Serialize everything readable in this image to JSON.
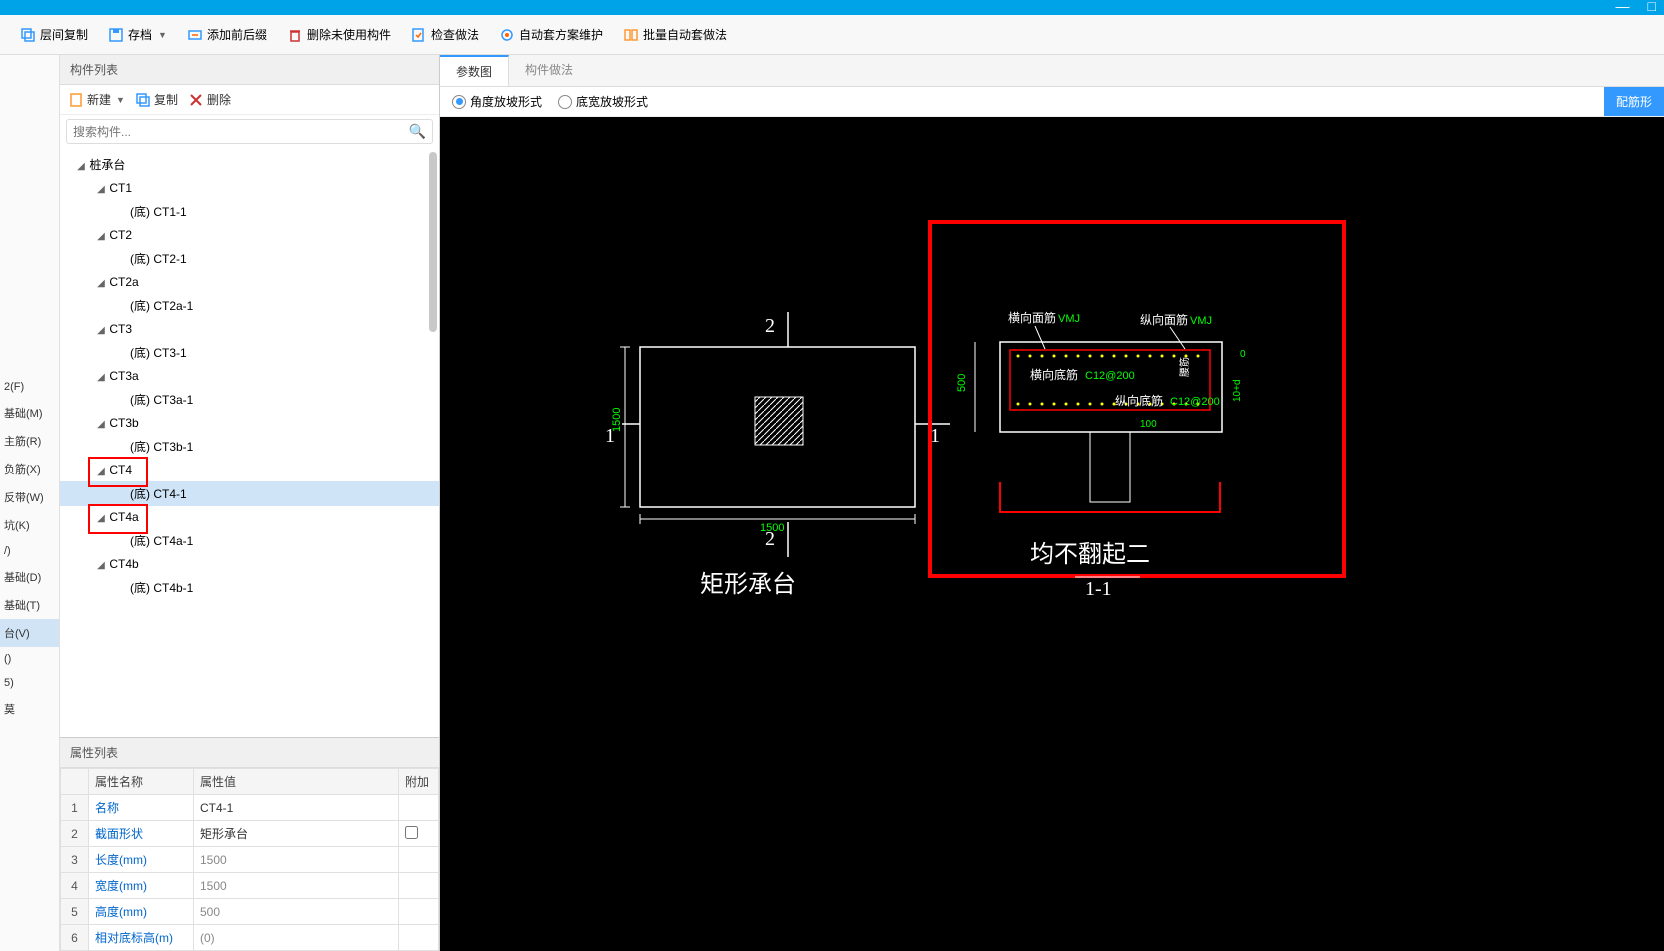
{
  "toolbar": [
    {
      "label": "层间复制"
    },
    {
      "label": "存档",
      "dropdown": true
    },
    {
      "label": "添加前后缀"
    },
    {
      "label": "删除未使用构件"
    },
    {
      "label": "检查做法"
    },
    {
      "label": "自动套方案维护"
    },
    {
      "label": "批量自动套做法"
    }
  ],
  "left_sidebar": [
    {
      "label": "2(F)"
    },
    {
      "label": "基础(M)"
    },
    {
      "label": "主筋(R)"
    },
    {
      "label": "负筋(X)"
    },
    {
      "label": "反带(W)"
    },
    {
      "label": "坑(K)"
    },
    {
      "label": "/)"
    },
    {
      "label": "基础(D)"
    },
    {
      "label": "基础(T)"
    },
    {
      "label": "台(V)",
      "active": true
    },
    {
      "label": "()"
    },
    {
      "label": "5)"
    },
    {
      "label": "莫"
    }
  ],
  "center": {
    "header": "构件列表",
    "tools": {
      "new": "新建",
      "copy": "复制",
      "delete": "删除"
    },
    "search_placeholder": "搜索构件...",
    "tree": [
      {
        "level": 0,
        "label": "桩承台",
        "expanded": true
      },
      {
        "level": 1,
        "label": "CT1",
        "expanded": true
      },
      {
        "level": 2,
        "label": "(底) CT1-1"
      },
      {
        "level": 1,
        "label": "CT2",
        "expanded": true
      },
      {
        "level": 2,
        "label": "(底) CT2-1"
      },
      {
        "level": 1,
        "label": "CT2a",
        "expanded": true
      },
      {
        "level": 2,
        "label": "(底) CT2a-1"
      },
      {
        "level": 1,
        "label": "CT3",
        "expanded": true
      },
      {
        "level": 2,
        "label": "(底) CT3-1"
      },
      {
        "level": 1,
        "label": "CT3a",
        "expanded": true
      },
      {
        "level": 2,
        "label": "(底) CT3a-1"
      },
      {
        "level": 1,
        "label": "CT3b",
        "expanded": true
      },
      {
        "level": 2,
        "label": "(底) CT3b-1"
      },
      {
        "level": 1,
        "label": "CT4",
        "expanded": true,
        "redbox": true
      },
      {
        "level": 2,
        "label": "(底) CT4-1",
        "selected": true
      },
      {
        "level": 1,
        "label": "CT4a",
        "expanded": true,
        "redbox": true
      },
      {
        "level": 2,
        "label": "(底) CT4a-1"
      },
      {
        "level": 1,
        "label": "CT4b",
        "expanded": true
      },
      {
        "level": 2,
        "label": "(底) CT4b-1"
      }
    ]
  },
  "props": {
    "header": "属性列表",
    "columns": [
      "属性名称",
      "属性值",
      "附加"
    ],
    "rows": [
      {
        "n": 1,
        "name": "名称",
        "value": "CT4-1",
        "black": true
      },
      {
        "n": 2,
        "name": "截面形状",
        "value": "矩形承台",
        "black": true,
        "checkbox": true
      },
      {
        "n": 3,
        "name": "长度(mm)",
        "value": "1500"
      },
      {
        "n": 4,
        "name": "宽度(mm)",
        "value": "1500"
      },
      {
        "n": 5,
        "name": "高度(mm)",
        "value": "500"
      },
      {
        "n": 6,
        "name": "相对底标高(m)",
        "value": "(0)"
      }
    ]
  },
  "right": {
    "tabs": [
      {
        "label": "参数图",
        "active": true
      },
      {
        "label": "构件做法"
      }
    ],
    "radios": [
      {
        "label": "角度放坡形式",
        "on": true
      },
      {
        "label": "底宽放坡形式"
      }
    ],
    "button": "配筋形",
    "canvas": {
      "left_title": "矩形承台",
      "right_title": "均不翻起二",
      "section_label": "1-1",
      "dim_h": "1500",
      "dim_v": "1500",
      "dim_section_v": "500",
      "dim_section_small1": "100",
      "dim_section_small2": "10+d",
      "dim_section_small3": "0",
      "mark1": "1",
      "mark2": "2",
      "rebar1": "横向面筋",
      "rebar1v": "VMJ",
      "rebar2": "纵向面筋",
      "rebar2v": "VMJ",
      "rebar3": "横向底筋",
      "rebar3v": "C12@200",
      "rebar4": "纵向底筋",
      "rebar4v": "C12@200",
      "waist": "腰筋"
    }
  }
}
